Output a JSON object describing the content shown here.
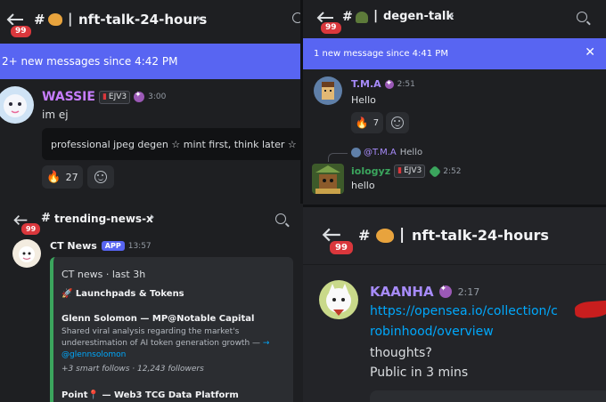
{
  "top_left": {
    "badge": "99",
    "channel_name": "nft-talk-24-hours",
    "new_messages_banner": "2+ new messages since 4:42 PM",
    "message": {
      "author": "WASSIE",
      "tag": "EJV3",
      "time": "3:00",
      "text": "im ej",
      "embed_text": "professional jpeg degen ☆ mint first, think later ☆ EJ ☆",
      "reaction_count": "27"
    }
  },
  "top_right": {
    "badge": "99",
    "channel_name": "degen-talk",
    "new_messages_banner": "1 new message since 4:41 PM",
    "message1": {
      "author": "T.M.A",
      "time": "2:51",
      "text": "Hello",
      "reaction_count": "7"
    },
    "message2": {
      "reply_to": "@T.M.A",
      "reply_text": "Hello",
      "author": "iologyz",
      "tag": "EJV3",
      "time": "2:52",
      "text": "hello"
    }
  },
  "bottom_left": {
    "badge": "99",
    "channel_name": "trending-news-x",
    "message": {
      "author": "CT News",
      "app_label": "APP",
      "time": "13:57",
      "embed_title": "CT news · last 3h",
      "section_heading": "🚀 Launchpads & Tokens",
      "item1_title": "Glenn Solomon — MP@Notable Capital",
      "item1_body": "Shared viral analysis regarding the market's underestimation of AI token generation growth —",
      "item1_handle": "@glennsolomon",
      "item1_stats": "+3 smart follows · 12,243 followers",
      "item2_title": "Point📍 — Web3 TCG Data Platform"
    }
  },
  "bottom_right": {
    "badge": "99",
    "channel_name": "nft-talk-24-hours",
    "message": {
      "author": "KAANHA",
      "time": "2:17",
      "link_line1": "https://opensea.io/collection/c",
      "link_line2": "robinhood/overview",
      "text_line1": "thoughts?",
      "text_line2": "Public in 3 mins"
    }
  },
  "colors": {
    "accent": "#5865f2",
    "badge_red": "#da373c",
    "wassie_name": "#c77dff",
    "tma_name": "#a78bfa",
    "iologyz_name": "#3ba55d",
    "link": "#00a8fc",
    "embed_bar": "#3ba55d"
  },
  "icons": [
    "back-arrow-icon",
    "search-icon",
    "fire-emoji-icon",
    "add-reaction-icon",
    "verified-badge-icon",
    "palette-emoji-icon",
    "close-icon"
  ]
}
